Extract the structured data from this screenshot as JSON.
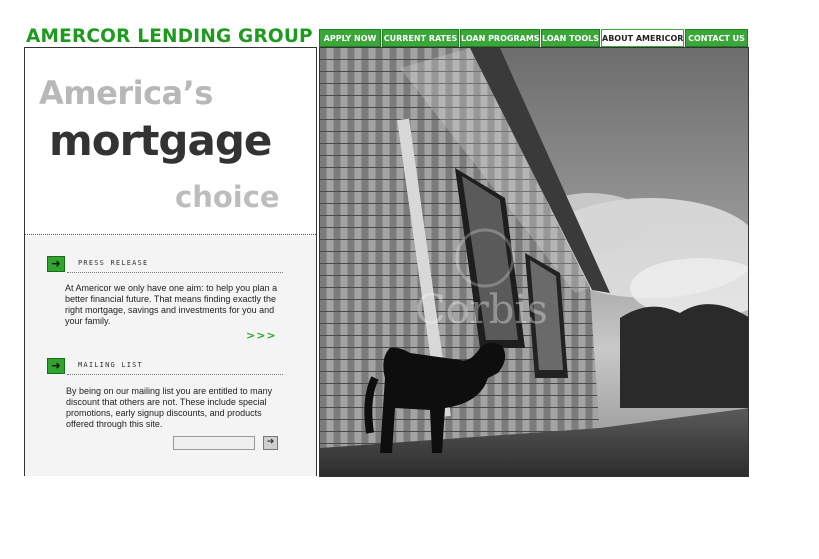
{
  "brand": {
    "name": "AMERCOR LENDING GROUP"
  },
  "nav": {
    "items": [
      {
        "label": "APPLY NOW"
      },
      {
        "label": "CURRENT RATES"
      },
      {
        "label": "LOAN PROGRAMS"
      },
      {
        "label": "LOAN TOOLS"
      },
      {
        "label": "ABOUT AMERICOR",
        "active": true
      },
      {
        "label": "CONTACT US"
      }
    ]
  },
  "hero": {
    "line1": "America’s",
    "line2": "mortgage",
    "line3": "choice"
  },
  "press": {
    "title": "PRESS RELEASE",
    "body": "At Americor we only have one aim: to help you plan a better financial future. That means finding exactly the right mortgage, savings and investments for you and your family.",
    "more": ">>>"
  },
  "mailing": {
    "title": "MAILING LIST",
    "body": "By being on our mailing list you are entitled to many discount that others are not. These include special promotions, early signup discounts, and products offered through this site.",
    "input_value": "",
    "go_icon": "arrow-right-icon"
  },
  "photo": {
    "watermark": "Corbis",
    "subject": "house-and-dog-photo"
  },
  "colors": {
    "brand_green": "#1e9a1e",
    "nav_green": "#3ba73b",
    "panel_gray": "#f4f4f4"
  }
}
